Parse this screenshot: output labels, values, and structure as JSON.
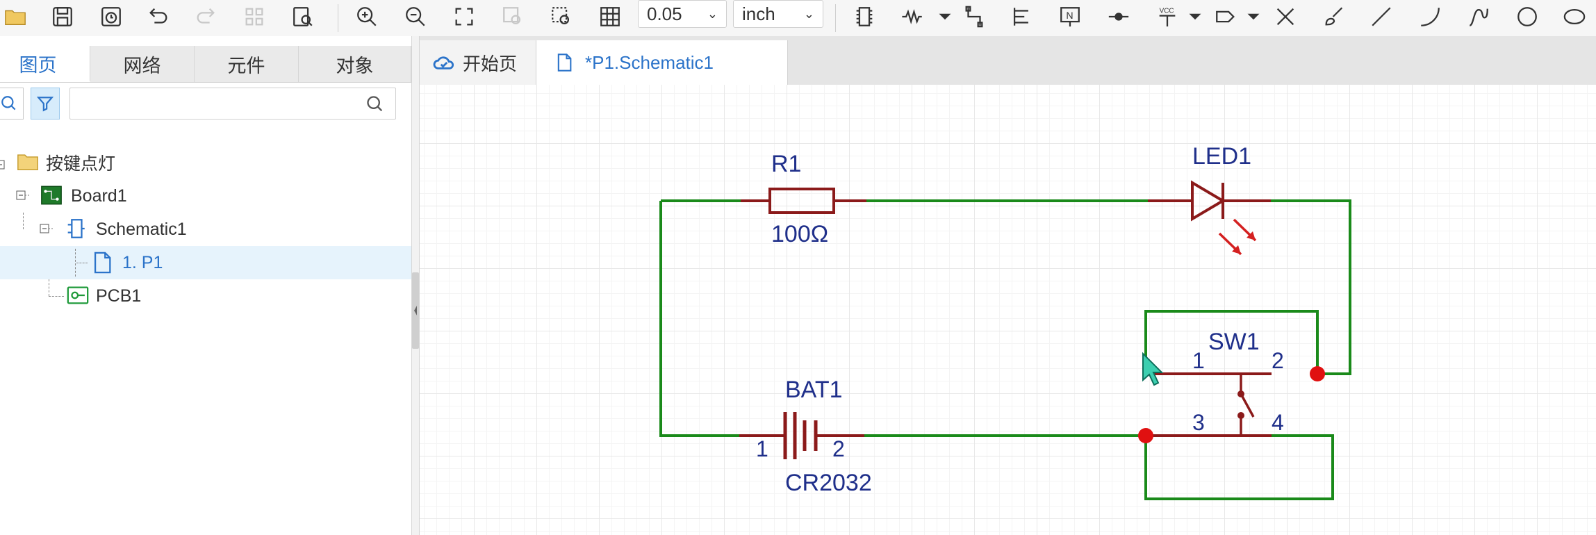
{
  "toolbar": {
    "grid_size": "0.05",
    "unit": "inch",
    "icons": [
      "folder-icon",
      "save-icon",
      "save-clock-icon",
      "undo-icon",
      "redo-icon",
      "grid-select-icon",
      "find-icon",
      "zoom-in-icon",
      "zoom-out-icon",
      "fit-icon",
      "zoom-area-icon",
      "zoom-select-icon",
      "grid-icon",
      "chip-icon",
      "resistor-tool-icon",
      "wire-tool-icon",
      "bus-icon",
      "netlabel-icon",
      "junction-icon",
      "vcc-icon",
      "netport-icon",
      "no-connect-icon",
      "brush-icon",
      "line-icon",
      "arc-icon",
      "curve-icon",
      "circle-icon",
      "ellipse-icon"
    ]
  },
  "left_panel": {
    "tabs": [
      "图页",
      "网络",
      "元件",
      "对象"
    ],
    "active_tab": 0,
    "search_placeholder": "",
    "tree": [
      {
        "label": "按键点灯",
        "icon": "folder-icon",
        "depth": 0
      },
      {
        "label": "Board1",
        "icon": "board-icon",
        "depth": 1
      },
      {
        "label": "Schematic1",
        "icon": "schematic-icon",
        "depth": 2
      },
      {
        "label": "1. P1",
        "icon": "page-icon",
        "depth": 3,
        "selected": true
      },
      {
        "label": "PCB1",
        "icon": "pcb-icon",
        "depth": 2
      }
    ]
  },
  "doc_tabs": [
    {
      "label": "开始页",
      "icon": "cloud-icon"
    },
    {
      "label": "*P1.Schematic1",
      "icon": "page-icon",
      "active": true
    }
  ],
  "schematic": {
    "r1": {
      "ref": "R1",
      "value": "100Ω"
    },
    "led1": {
      "ref": "LED1"
    },
    "sw1": {
      "ref": "SW1",
      "pins": [
        "1",
        "2",
        "3",
        "4"
      ]
    },
    "bat1": {
      "ref": "BAT1",
      "value": "CR2032",
      "pins": [
        "1",
        "2"
      ]
    },
    "colors": {
      "wire": "#1a8a1a",
      "component": "#8b1a1a",
      "junction": "#e01010",
      "label": "#1f2f8a"
    }
  }
}
